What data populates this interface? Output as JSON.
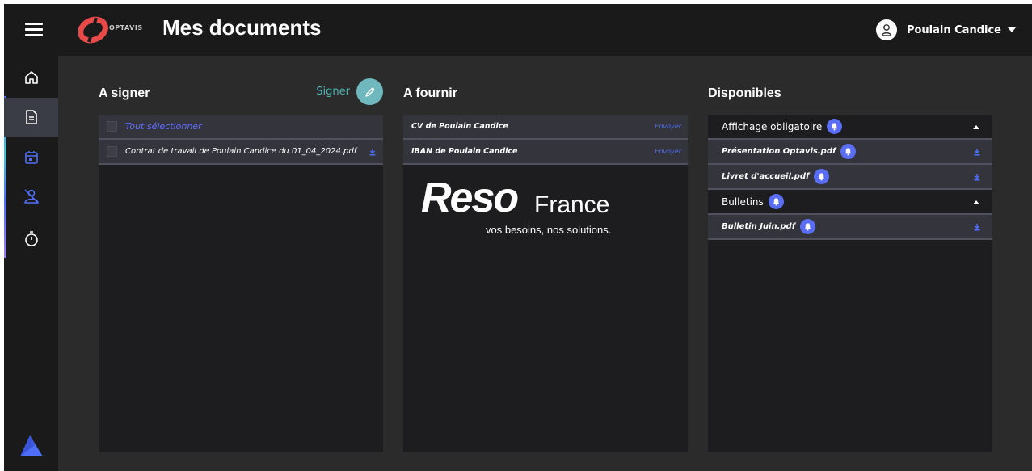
{
  "header": {
    "title": "Mes documents",
    "logo_text": "OPTAVIS",
    "user_name": "Poulain Candice"
  },
  "sidebar": {
    "items": [
      {
        "icon": "home-icon"
      },
      {
        "icon": "document-icon",
        "active": true
      },
      {
        "icon": "calendar-icon"
      },
      {
        "icon": "user-off-icon"
      },
      {
        "icon": "stopwatch-icon"
      }
    ]
  },
  "columns": {
    "sign": {
      "title": "A signer",
      "action_label": "Signer",
      "select_all": "Tout sélectionner",
      "documents": [
        "Contrat de travail de Poulain Candice du 01_04_2024.pdf"
      ]
    },
    "provide": {
      "title": "A fournir",
      "documents": [
        {
          "name": "CV de Poulain Candice",
          "action": "Envoyer"
        },
        {
          "name": "IBAN de Poulain Candice",
          "action": "Envoyer"
        }
      ]
    },
    "available": {
      "title": "Disponibles",
      "groups": [
        {
          "name": "Affichage obligatoire",
          "files": [
            "Présentation Optavis.pdf",
            "Livret d'accueil.pdf"
          ]
        },
        {
          "name": "Bulletins",
          "files": [
            "Bulletin Juin.pdf"
          ]
        }
      ]
    }
  },
  "watermark": {
    "brand": "Reso",
    "brand2": "France",
    "tagline": "vos besoins, nos solutions."
  },
  "colors": {
    "accent_blue": "#4f6ef7",
    "accent_teal": "#6fb8be",
    "logo_red": "#e84a4a"
  }
}
